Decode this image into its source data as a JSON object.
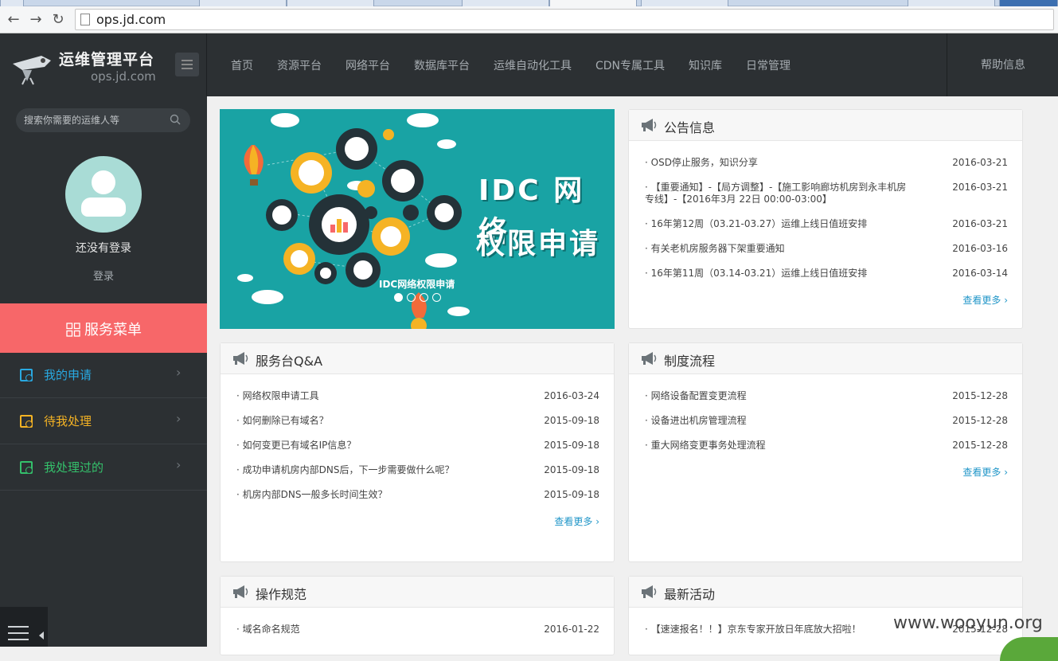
{
  "browser": {
    "url": "ops.jd.com",
    "back_glyph": "←",
    "forward_glyph": "→",
    "reload_glyph": "↻"
  },
  "header": {
    "logo_title": "运维管理平台",
    "logo_subtitle": "ops.jd.com",
    "nav": [
      "首页",
      "资源平台",
      "网络平台",
      "数据库平台",
      "运维自动化工具",
      "CDN专属工具",
      "知识库",
      "日常管理"
    ],
    "help": "帮助信息"
  },
  "sidebar": {
    "search_placeholder": "搜索你需要的运维人等",
    "login_status": "还没有登录",
    "login_link": "登录",
    "service_menu": "服务菜单",
    "items": [
      {
        "label": "我的申请",
        "color": "#29a9e1"
      },
      {
        "label": "待我处理",
        "color": "#f5b324"
      },
      {
        "label": "我处理过的",
        "color": "#34c06b"
      }
    ],
    "chevron": "›"
  },
  "banner": {
    "title_line1": "IDC 网络",
    "title_line2": "权限申请",
    "caption": "IDC网络权限申请",
    "slide_count": 4,
    "active_slide": 1
  },
  "more_label": "查看更多",
  "panels": {
    "announcements": {
      "title": "公告信息",
      "items": [
        {
          "text": "· OSD停止服务，知识分享",
          "date": "2016-03-21"
        },
        {
          "text": "· 【重要通知】-【局方调整】-【施工影响廊坊机房到永丰机房专线】-【2016年3月 22日 00:00-03:00】",
          "date": "2016-03-21"
        },
        {
          "text": "· 16年第12周（03.21-03.27）运维上线日值班安排",
          "date": "2016-03-21"
        },
        {
          "text": "· 有关老机房服务器下架重要通知",
          "date": "2016-03-16"
        },
        {
          "text": "· 16年第11周（03.14-03.21）运维上线日值班安排",
          "date": "2016-03-14"
        }
      ]
    },
    "qa": {
      "title": "服务台Q&A",
      "items": [
        {
          "text": "· 网络权限申请工具",
          "date": "2016-03-24"
        },
        {
          "text": "· 如何删除已有域名？",
          "date": "2015-09-18"
        },
        {
          "text": "· 如何变更已有域名IP信息？",
          "date": "2015-09-18"
        },
        {
          "text": "· 成功申请机房内部DNS后，下一步需要做什么呢？",
          "date": "2015-09-18"
        },
        {
          "text": "· 机房内部DNS一般多长时间生效？",
          "date": "2015-09-18"
        }
      ]
    },
    "process": {
      "title": "制度流程",
      "items": [
        {
          "text": "· 网络设备配置变更流程",
          "date": "2015-12-28"
        },
        {
          "text": "· 设备进出机房管理流程",
          "date": "2015-12-28"
        },
        {
          "text": "· 重大网络变更事务处理流程",
          "date": "2015-12-28"
        }
      ]
    },
    "ops_spec": {
      "title": "操作规范",
      "items": [
        {
          "text": "· 域名命名规范",
          "date": "2016-01-22"
        }
      ]
    },
    "activities": {
      "title": "最新活动",
      "items": [
        {
          "text": "· 【速速报名！！】京东专家开放日年底放大招啦！",
          "date": "2015-12-28"
        }
      ]
    }
  },
  "watermark": "www.wooyun.org"
}
